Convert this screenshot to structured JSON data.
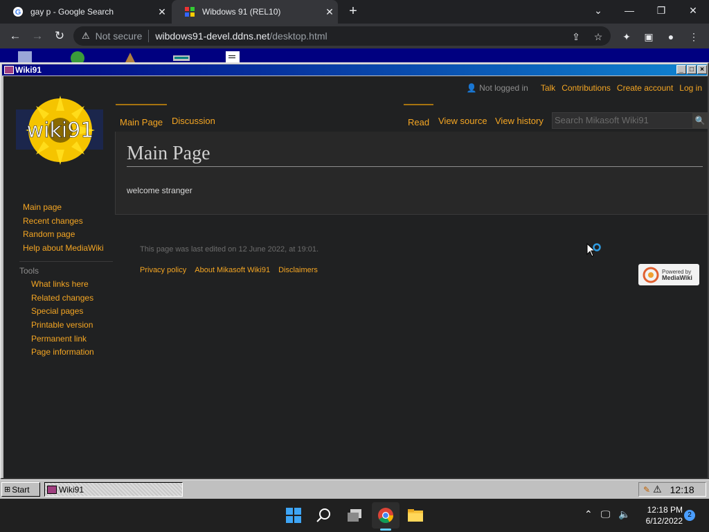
{
  "browser": {
    "tabs": [
      {
        "title": "gay p - Google Search",
        "favicon": "google-g-icon"
      },
      {
        "title": "Wibdows 91 (REL10)",
        "favicon": "wibdows-icon"
      }
    ],
    "new_tab_label": "+",
    "url": {
      "security_label": "Not secure",
      "host": "wibdows91-devel.ddns.net",
      "path": "/desktop.html"
    }
  },
  "window": {
    "title": "Wiki91"
  },
  "wiki": {
    "personal": {
      "user": "Not logged in",
      "talk": "Talk",
      "contributions": "Contributions",
      "create_account": "Create account",
      "log_in": "Log in"
    },
    "logo_text": "wiki91",
    "nav": [
      "Main page",
      "Recent changes",
      "Random page",
      "Help about MediaWiki"
    ],
    "tools_heading": "Tools",
    "tools": [
      "What links here",
      "Related changes",
      "Special pages",
      "Printable version",
      "Permanent link",
      "Page information"
    ],
    "tabs": {
      "main_page": "Main Page",
      "discussion": "Discussion",
      "read": "Read",
      "view_source": "View source",
      "view_history": "View history"
    },
    "search_placeholder": "Search Mikasoft Wiki91",
    "heading": "Main Page",
    "body_text": "welcome stranger",
    "last_modified": "This page was last edited on 12 June 2022, at 19:01.",
    "footer_links": [
      "Privacy policy",
      "About Mikasoft Wiki91",
      "Disclaimers"
    ],
    "powered_by": [
      "Powered by",
      "MediaWiki"
    ]
  },
  "w91_taskbar": {
    "start_label": "Start",
    "task_label": "Wiki91",
    "clock": "12:18"
  },
  "w11_taskbar": {
    "time": "12:18 PM",
    "date": "6/12/2022",
    "notification_count": "2"
  },
  "colors": {
    "link": "#f5a623",
    "page_bg": "#202122",
    "title_bar": "#000080"
  }
}
